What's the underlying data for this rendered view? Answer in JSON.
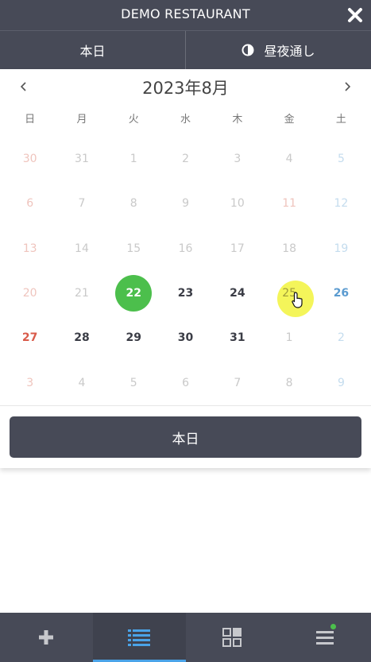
{
  "app": {
    "title": "DEMO RESTAURANT"
  },
  "mode": {
    "today_label": "本日",
    "allday_label": "昼夜通し"
  },
  "calendar": {
    "month_label": "2023年8月",
    "weekdays": [
      "日",
      "月",
      "火",
      "水",
      "木",
      "金",
      "土"
    ],
    "days": [
      {
        "d": "30",
        "state": "out"
      },
      {
        "d": "31",
        "state": "out"
      },
      {
        "d": "1",
        "state": "past"
      },
      {
        "d": "2",
        "state": "past"
      },
      {
        "d": "3",
        "state": "past"
      },
      {
        "d": "4",
        "state": "past"
      },
      {
        "d": "5",
        "state": "past"
      },
      {
        "d": "6",
        "state": "past"
      },
      {
        "d": "7",
        "state": "past"
      },
      {
        "d": "8",
        "state": "past"
      },
      {
        "d": "9",
        "state": "past"
      },
      {
        "d": "10",
        "state": "past"
      },
      {
        "d": "11",
        "state": "past-holiday"
      },
      {
        "d": "12",
        "state": "past"
      },
      {
        "d": "13",
        "state": "past"
      },
      {
        "d": "14",
        "state": "past"
      },
      {
        "d": "15",
        "state": "past"
      },
      {
        "d": "16",
        "state": "past"
      },
      {
        "d": "17",
        "state": "past"
      },
      {
        "d": "18",
        "state": "past"
      },
      {
        "d": "19",
        "state": "past"
      },
      {
        "d": "20",
        "state": "past"
      },
      {
        "d": "21",
        "state": "past"
      },
      {
        "d": "22",
        "state": "today"
      },
      {
        "d": "23",
        "state": "active"
      },
      {
        "d": "24",
        "state": "active"
      },
      {
        "d": "25",
        "state": "hover"
      },
      {
        "d": "26",
        "state": "active"
      },
      {
        "d": "27",
        "state": "active"
      },
      {
        "d": "28",
        "state": "active"
      },
      {
        "d": "29",
        "state": "active"
      },
      {
        "d": "30",
        "state": "active"
      },
      {
        "d": "31",
        "state": "active"
      },
      {
        "d": "1",
        "state": "out"
      },
      {
        "d": "2",
        "state": "out"
      },
      {
        "d": "3",
        "state": "out"
      },
      {
        "d": "4",
        "state": "out"
      },
      {
        "d": "5",
        "state": "out"
      },
      {
        "d": "6",
        "state": "out"
      },
      {
        "d": "7",
        "state": "out"
      },
      {
        "d": "8",
        "state": "out"
      },
      {
        "d": "9",
        "state": "out"
      }
    ],
    "today_button_label": "本日"
  },
  "bottom_nav": {
    "tabs": [
      {
        "name": "add",
        "icon": "plus-icon",
        "selected": false
      },
      {
        "name": "list",
        "icon": "list-icon",
        "selected": true
      },
      {
        "name": "grid",
        "icon": "grid-icon",
        "selected": false
      },
      {
        "name": "menu",
        "icon": "menu-icon",
        "selected": false,
        "badge": true
      }
    ]
  },
  "colors": {
    "header_bg": "#474a57",
    "today_green": "#4cbf4c",
    "hover_yellow": "#f4f55a",
    "sunday_red": "#d95b4a",
    "saturday_blue": "#5b9bd0",
    "nav_accent": "#4aa3e8"
  }
}
